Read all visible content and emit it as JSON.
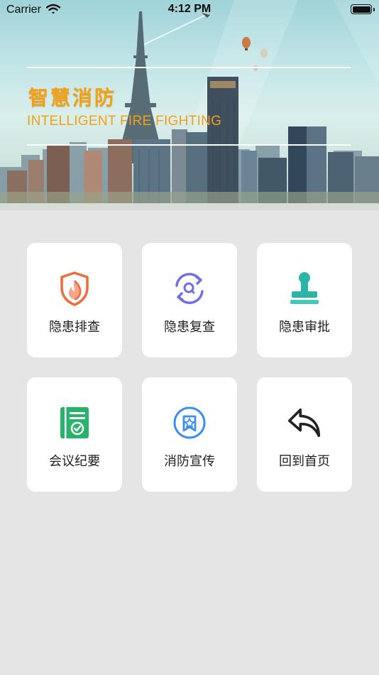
{
  "status_bar": {
    "carrier": "Carrier",
    "time": "4:12 PM"
  },
  "banner": {
    "title": "智慧消防",
    "subtitle": "INTELLIGENT FIRE FIGHTING",
    "title_color": "#f5a012"
  },
  "menu": [
    {
      "label": "隐患排查",
      "icon": "fire-shield-icon",
      "color": "#f06a3a"
    },
    {
      "label": "隐患复查",
      "icon": "refresh-search-icon",
      "color": "#6f6fe6"
    },
    {
      "label": "隐患审批",
      "icon": "stamp-icon",
      "color": "#2bb5a6"
    },
    {
      "label": "会议纪要",
      "icon": "document-check-icon",
      "color": "#27b36a"
    },
    {
      "label": "消防宣传",
      "icon": "star-badge-icon",
      "color": "#3b8ef2"
    },
    {
      "label": "回到首页",
      "icon": "back-arrow-icon",
      "color": "#222222"
    }
  ],
  "background_color": "#e5e5e5"
}
